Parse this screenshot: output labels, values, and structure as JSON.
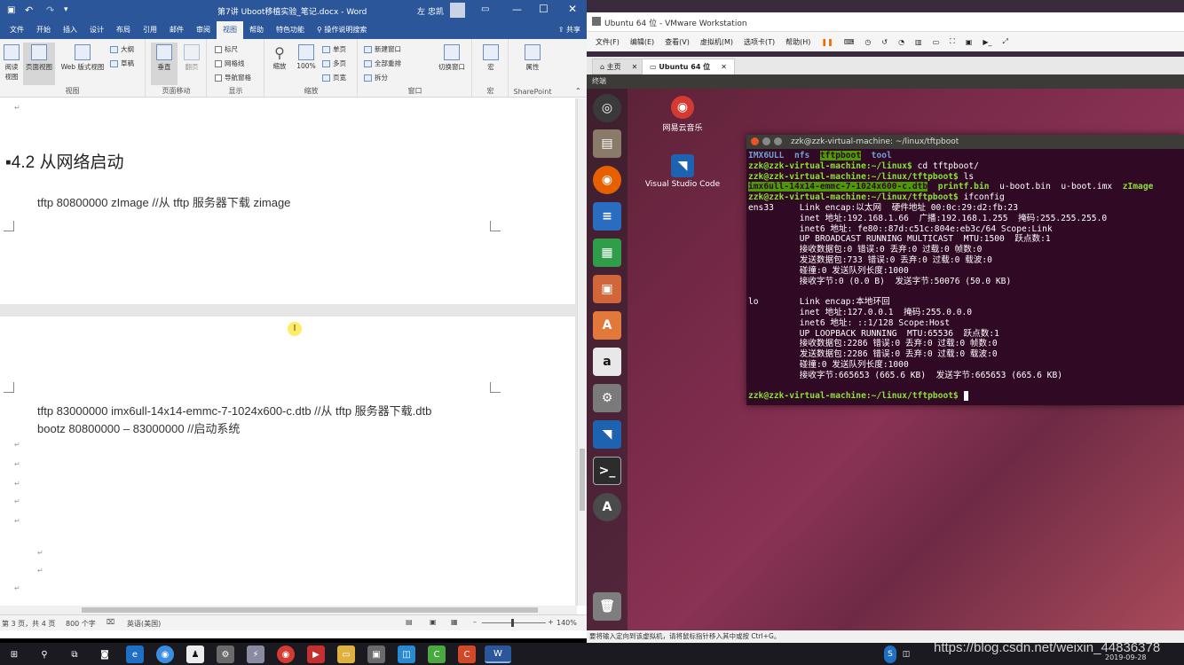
{
  "word": {
    "title": "第7讲 Uboot移植实验_笔记.docx  -  Word",
    "user": "左 忠凯",
    "tabs": [
      "文件",
      "开始",
      "插入",
      "设计",
      "布局",
      "引用",
      "邮件",
      "审阅",
      "视图",
      "帮助",
      "特色功能"
    ],
    "active_tab": "视图",
    "tell_me": "操作说明搜索",
    "share": "共享",
    "ribbon": {
      "views": {
        "read": "阅读视图",
        "print": "页面视图",
        "web": "Web 版式视图",
        "outline": "大纲",
        "draft": "草稿",
        "label": "视图"
      },
      "page_move": {
        "vertical": "垂直",
        "side": "翻页",
        "label": "页面移动"
      },
      "show": {
        "ruler": "标尺",
        "gridlines": "网格线",
        "nav": "导航窗格",
        "label": "显示"
      },
      "zoom": {
        "zoom": "缩放",
        "pct": "100%",
        "one": "单页",
        "multi": "多页",
        "width": "页宽",
        "label": "缩放"
      },
      "window": {
        "new": "新建窗口",
        "arrange": "全部重排",
        "split": "拆分",
        "switch": "切换窗口",
        "label": "窗口"
      },
      "macro": {
        "btn": "宏",
        "label": "宏"
      },
      "sharepoint": {
        "btn": "属性",
        "label": "SharePoint"
      }
    },
    "doc": {
      "heading": "4.2  从网络启动",
      "line1": "tftp 80800000 zImage        //从 tftp 服务器下载 zimage",
      "line2": "tftp 83000000 imx6ull-14x14-emmc-7-1024x600-c.dtb //从 tftp 服务器下载.dtb",
      "line3": "bootz 80800000 – 83000000 //启动系统"
    },
    "status": {
      "page": "第 3 页，共 4 页",
      "words": "800 个字",
      "lang": "英语(美国)",
      "zoom": "140%"
    }
  },
  "vmware": {
    "title": "Ubuntu 64 位 - VMware Workstation",
    "menu": [
      "文件(F)",
      "编辑(E)",
      "查看(V)",
      "虚拟机(M)",
      "选项卡(T)",
      "帮助(H)"
    ],
    "tabs": [
      "主页",
      "Ubuntu 64 位"
    ],
    "label": "终端",
    "desktop_icons": [
      "网易云音乐",
      "Visual Studio Code"
    ],
    "terminal": {
      "title": "zzk@zzk-virtual-machine: ~/linux/tftpboot",
      "dirs": [
        "IMX6ULL",
        "nfs",
        "tftpboot",
        "tool"
      ],
      "prompt1": "zzk@zzk-virtual-machine:~/linux$",
      "cmd1": " cd tftpboot/",
      "prompt2": "zzk@zzk-virtual-machine:~/linux/tftpboot$",
      "cmd2": " ls",
      "files": [
        "imx6ull-14x14-emmc-7-1024x600-c.dtb",
        "printf.bin",
        "u-boot.bin",
        "u-boot.imx",
        "zImage"
      ],
      "cmd3": " ifconfig",
      "lines": [
        "ens33     Link encap:以太网  硬件地址 00:0c:29:d2:fb:23",
        "          inet 地址:192.168.1.66  广播:192.168.1.255  掩码:255.255.255.0",
        "          inet6 地址: fe80::87d:c51c:804e:eb3c/64 Scope:Link",
        "          UP BROADCAST RUNNING MULTICAST  MTU:1500  跃点数:1",
        "          接收数据包:0 错误:0 丢弃:0 过载:0 帧数:0",
        "          发送数据包:733 错误:0 丢弃:0 过载:0 载波:0",
        "          碰撞:0 发送队列长度:1000",
        "          接收字节:0 (0.0 B)  发送字节:50076 (50.0 KB)",
        "",
        "lo        Link encap:本地环回",
        "          inet 地址:127.0.0.1  掩码:255.0.0.0",
        "          inet6 地址: ::1/128 Scope:Host",
        "          UP LOOPBACK RUNNING  MTU:65536  跃点数:1",
        "          接收数据包:2286 错误:0 丢弃:0 过载:0 帧数:0",
        "          发送数据包:2286 错误:0 丢弃:0 过载:0 载波:0",
        "          碰撞:0 发送队列长度:1000",
        "          接收字节:665653 (665.6 KB)  发送字节:665653 (665.6 KB)",
        ""
      ]
    },
    "status": "要将输入定向到该虚拟机，请将鼠标指针移入其中或按 Ctrl+G。"
  },
  "taskbar": {
    "date": "2019-09-28"
  },
  "watermark": "https://blog.csdn.net/weixin_44836378",
  "colors": {
    "word_blue": "#2b579a",
    "terminal_bg": "#300a24",
    "prompt_green": "#8ae234",
    "dir_blue": "#729fcf"
  }
}
